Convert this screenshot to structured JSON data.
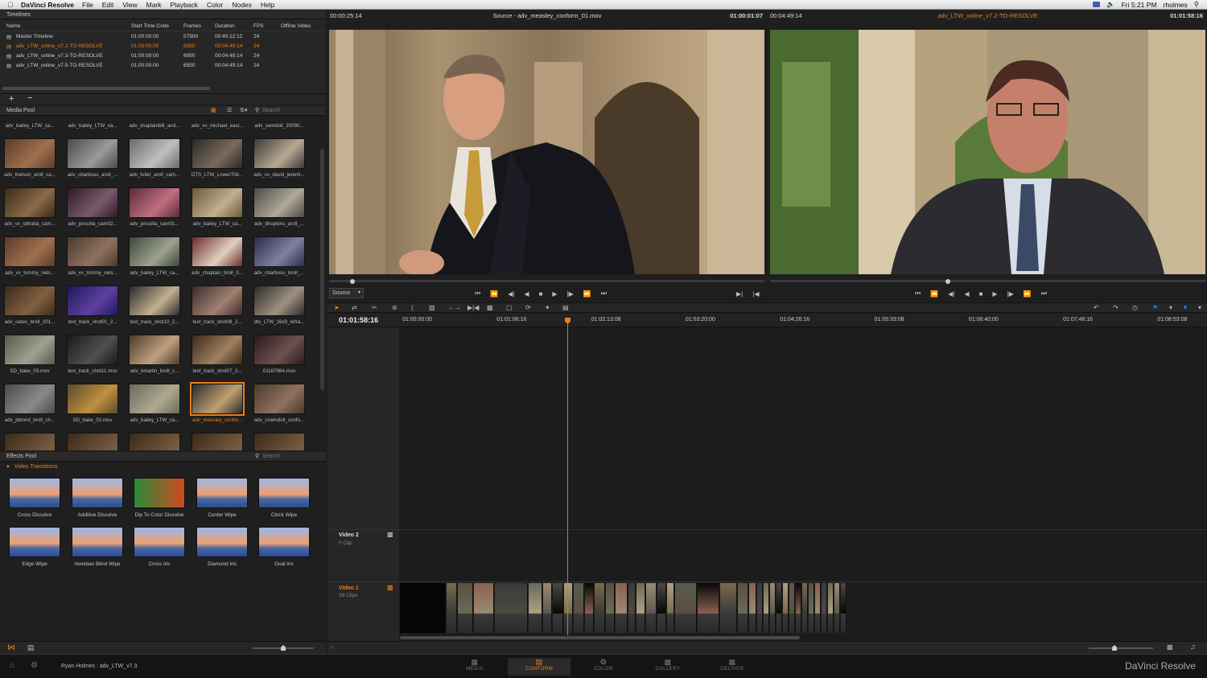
{
  "menubar": {
    "app_name": "DaVinci Resolve",
    "menus": [
      "File",
      "Edit",
      "View",
      "Mark",
      "Playback",
      "Color",
      "Nodes",
      "Help"
    ],
    "clock": "Fri 5:21 PM",
    "user": "rholmes"
  },
  "timelines": {
    "title": "Timelines",
    "columns": [
      "Name",
      "Start Time Code",
      "Frames",
      "Duration",
      "FPS",
      "Offline Video"
    ],
    "rows": [
      {
        "name": "Master Timeline",
        "start": "01:00:00:00",
        "frames": "57900",
        "duration": "00:40:12:12",
        "fps": "24"
      },
      {
        "name": "adv_LTW_online_v7.2-TO-RESOLVE",
        "start": "01:00:00:00",
        "frames": "6950",
        "duration": "00:04:49:14",
        "fps": "24"
      },
      {
        "name": "adv_LTW_online_v7.3-TO-RESOLVE",
        "start": "01:00:00:00",
        "frames": "6950",
        "duration": "00:04:49:14",
        "fps": "24"
      },
      {
        "name": "adv_LTW_online_v7.5-TO-RESOLVE",
        "start": "01:00:00:00",
        "frames": "6950",
        "duration": "00:04:49:14",
        "fps": "24"
      }
    ],
    "add_label": "+",
    "remove_label": "−"
  },
  "media_pool": {
    "title": "Media Pool",
    "search_placeholder": "Search",
    "top_labels": [
      "adv_bailey_LTW_ca...",
      "adv_bailey_LTW_ca...",
      "adv_chaplainbill_arol...",
      "adv_vv_michael_easl...",
      "adv_swindoll_20090..."
    ],
    "clips": [
      "adv_tnelson_aroll_ca...",
      "adv_cbarbosu_aroll_...",
      "adv_fuller_aroll_cam...",
      "DTS_LTW_LowerThir...",
      "adv_vv_david_jeremi...",
      "adv_vv_sbhatia_cam...",
      "adv_priscilla_cam02...",
      "adv_priscilla_cam01...",
      "adv_bailey_LTW_ca...",
      "adv_bhopkins_aroll_...",
      "adv_vv_tommy_nels...",
      "adv_vv_tommy_nels...",
      "adv_bailey_LTW_ca...",
      "adv_chaplain_broll_0...",
      "adv_cbarbosu_broll_...",
      "adv_oates_broll_201...",
      "text_track_shot01_2...",
      "text_track_shot10_2...",
      "text_track_shot08_2...",
      "dts_LTW_16x9_refra...",
      "SD_bake_03.mov",
      "text_track_shot11.mov",
      "adv_kmartin_broll_c...",
      "text_track_shot07_2...",
      "01167884.mov",
      "adv_jbbond_broll_ch...",
      "SD_bake_02.mov",
      "adv_bailey_LTW_ca...",
      "adv_measley_confor...",
      "adv_cswindoll_confo..."
    ],
    "selected_index": 28
  },
  "effects_pool": {
    "title": "Effects Pool",
    "search_placeholder": "Search",
    "category": "Video Transitions",
    "items": [
      "Cross Dissolve",
      "Additive Dissolve",
      "Dip To Color Dissolve",
      "Center Wipe",
      "Clock Wipe",
      "Edge Wipe",
      "Venetian Blind Wipe",
      "Cross Iris",
      "Diamond Iris",
      "Oval Iris"
    ]
  },
  "source_viewer": {
    "timecode_left": "00:00:25:14",
    "title": "Source - adv_measley_conform_01.mov",
    "timecode_right": "01:00:01:07",
    "dropdown": "Source"
  },
  "record_viewer": {
    "timecode_left": "00:04:49:14",
    "title": "adv_LTW_online_v7.2-TO-RESOLVE",
    "timecode_right": "01:01:58:16"
  },
  "timeline": {
    "current_tc": "01:01:58:16",
    "ruler": [
      "01:00:00:00",
      "01:01:06:16",
      "01:02:13:08",
      "01:03:20:00",
      "01:04:26:16",
      "01:05:33:08",
      "01:06:40:00",
      "01:07:46:16",
      "01:08:53:08"
    ],
    "playhead_fraction": 0.2,
    "tracks": [
      {
        "name": "Video 2",
        "clips": "0 Clip"
      },
      {
        "name": "Video 1",
        "clips": "38 Clips"
      }
    ]
  },
  "bottom": {
    "project": "Ryan Holmes : adv_LTW_v7.3",
    "pages": [
      "MEDIA",
      "CONFORM",
      "COLOR",
      "GALLERY",
      "DELIVER"
    ],
    "active_page": "CONFORM",
    "brand": "DaVinci Resolve"
  },
  "colors": {
    "accent": "#e8801a",
    "selection_blue": "#1e78d6"
  }
}
